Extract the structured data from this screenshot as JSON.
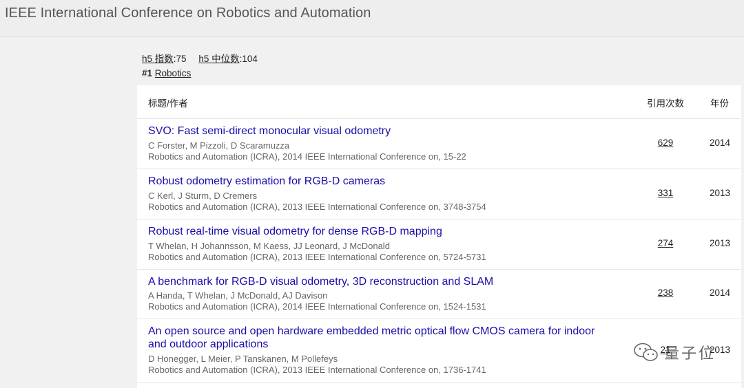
{
  "header": {
    "title": "IEEE International Conference on Robotics and Automation"
  },
  "metrics": {
    "h5_index_label": "h5 指数",
    "h5_index_value": ":75",
    "h5_median_label": "h5 中位数",
    "h5_median_value": ":104"
  },
  "rank": {
    "number": "#1",
    "category": "Robotics"
  },
  "table": {
    "headers": {
      "title_authors": "标题/作者",
      "citations": "引用次数",
      "year": "年份"
    },
    "rows": [
      {
        "title": "SVO: Fast semi-direct monocular visual odometry",
        "authors": "C Forster, M Pizzoli, D Scaramuzza",
        "venue": "Robotics and Automation (ICRA), 2014 IEEE International Conference on, 15-22",
        "citations": "629",
        "year": "2014"
      },
      {
        "title": "Robust odometry estimation for RGB-D cameras",
        "authors": "C Kerl, J Sturm, D Cremers",
        "venue": "Robotics and Automation (ICRA), 2013 IEEE International Conference on, 3748-3754",
        "citations": "331",
        "year": "2013"
      },
      {
        "title": "Robust real-time visual odometry for dense RGB-D mapping",
        "authors": "T Whelan, H Johannsson, M Kaess, JJ Leonard, J McDonald",
        "venue": "Robotics and Automation (ICRA), 2013 IEEE International Conference on, 5724-5731",
        "citations": "274",
        "year": "2013"
      },
      {
        "title": "A benchmark for RGB-D visual odometry, 3D reconstruction and SLAM",
        "authors": "A Handa, T Whelan, J McDonald, AJ Davison",
        "venue": "Robotics and Automation (ICRA), 2014 IEEE International Conference on, 1524-1531",
        "citations": "238",
        "year": "2014"
      },
      {
        "title": "An open source and open hardware embedded metric optical flow CMOS camera for indoor and outdoor applications",
        "authors": "D Honegger, L Meier, P Tanskanen, M Pollefeys",
        "venue": "Robotics and Automation (ICRA), 2013 IEEE International Conference on, 1736-1741",
        "citations": "21",
        "year": "2013"
      }
    ]
  },
  "watermark": {
    "text": "量子位",
    "icon": "wechat-icon"
  },
  "colors": {
    "link": "#1a0dab",
    "secondary_text": "#666666",
    "page_bg": "#f1f1f1"
  }
}
